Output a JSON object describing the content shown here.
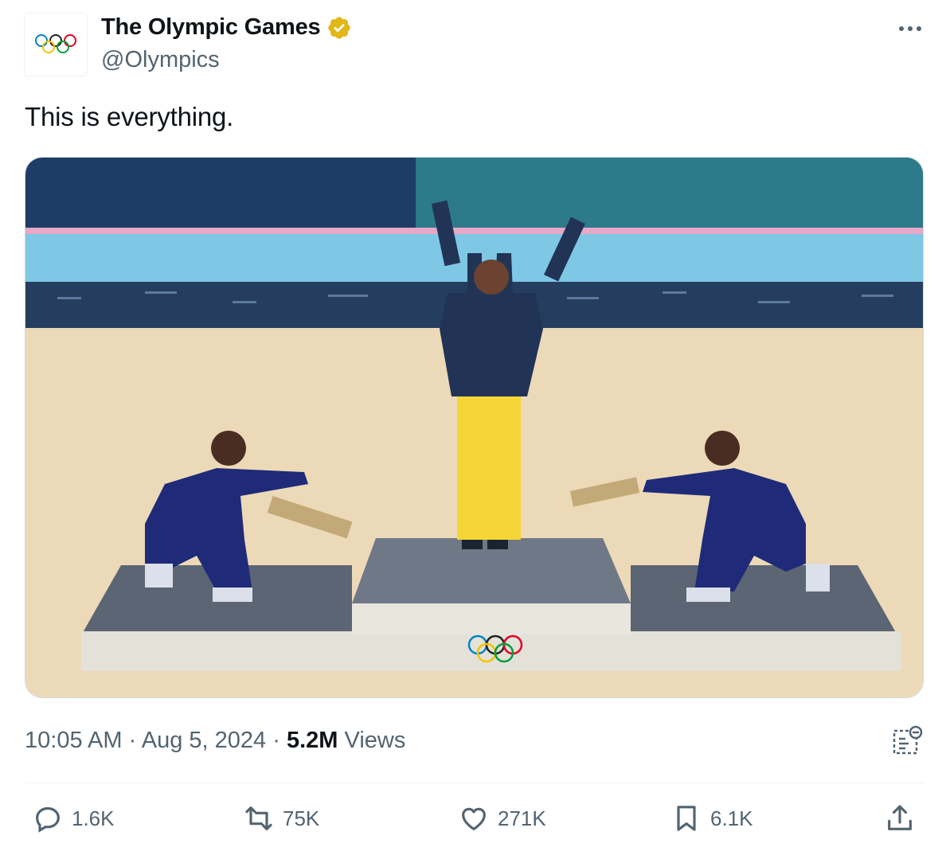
{
  "author": {
    "display_name": "The Olympic Games",
    "handle": "@Olympics",
    "verified_badge_icon": "verified-badge-icon",
    "avatar_icon": "olympic-rings-icon"
  },
  "tweet": {
    "text": "This is everything.",
    "media_description_icon": "gymnastics-podium-photo"
  },
  "meta": {
    "time": "10:05 AM",
    "separator": "·",
    "date": "Aug 5, 2024",
    "views_count": "5.2M",
    "views_label": "Views"
  },
  "actions": {
    "reply": {
      "icon": "reply-icon",
      "count": "1.6K"
    },
    "retweet": {
      "icon": "retweet-icon",
      "count": "75K"
    },
    "like": {
      "icon": "heart-icon",
      "count": "271K"
    },
    "bookmark": {
      "icon": "bookmark-icon",
      "count": "6.1K"
    },
    "share": {
      "icon": "share-icon"
    }
  },
  "colors": {
    "text_primary": "#0f1419",
    "text_secondary": "#536471",
    "verified_gold": "#e2b719",
    "border": "#cfd9de"
  }
}
